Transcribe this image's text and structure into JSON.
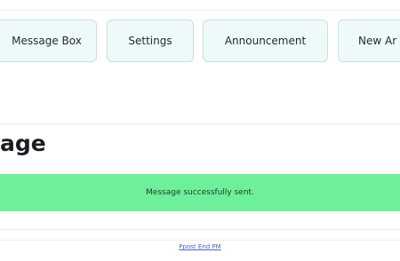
{
  "nav": {
    "message_box": "Message Box",
    "settings": "Settings",
    "announcement": "Announcement",
    "new_announcement_partial": "New Ar"
  },
  "page": {
    "title_partial": "age"
  },
  "alert": {
    "text": "Message successfully sent."
  },
  "footer": {
    "link_text": "Ppost End PM"
  },
  "colors": {
    "button_bg": "#eefaf9",
    "button_border": "#c6e2df",
    "success_bg": "#6ef09a",
    "link": "#4a65b8"
  }
}
